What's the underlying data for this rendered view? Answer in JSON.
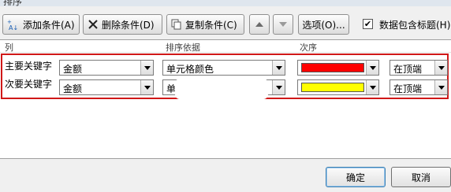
{
  "window": {
    "title": "排序"
  },
  "toolbar": {
    "add_condition": "添加条件(A)",
    "delete_condition": "删除条件(D)",
    "copy_condition": "复制条件(C)",
    "options": "选项(O)...",
    "has_headers_label": "数据包含标题(H)",
    "has_headers_checked": true
  },
  "columns": {
    "column": "列",
    "sort_on": "排序依据",
    "order": "次序"
  },
  "rows": [
    {
      "label": "主要关键字",
      "column_value": "金额",
      "sort_on_value": "单元格颜色",
      "order_color": "#ff0000",
      "position_value": "在顶端"
    },
    {
      "label": "次要关键字",
      "column_value": "金额",
      "sort_on_value": "单",
      "order_color": "#ffff00",
      "position_value": "在顶端"
    }
  ],
  "footer": {
    "ok": "确定",
    "cancel": "取消"
  },
  "colors": {
    "highlight_border": "#d01818"
  }
}
